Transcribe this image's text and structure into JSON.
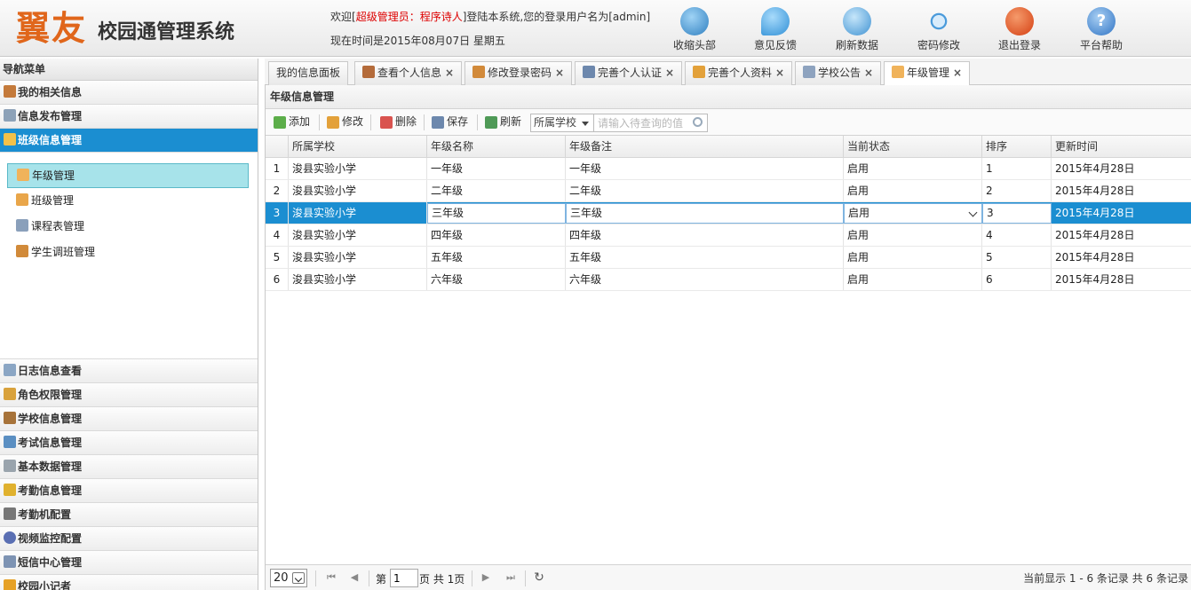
{
  "header": {
    "logo": "翼友",
    "system_name": "校园通管理系统",
    "welcome_prefix": "欢迎[",
    "welcome_role": "超级管理员：程序诗人",
    "welcome_suffix": "]登陆本系统,您的登录用户名为[admin]",
    "current_time": "现在时间是2015年08月07日 星期五",
    "buttons": [
      {
        "label": "收缩头部",
        "icon": "collapse-icon",
        "color": "#3a8fc9"
      },
      {
        "label": "意见反馈",
        "icon": "chat-bubble-icon",
        "color": "#3d9fe0"
      },
      {
        "label": "刷新数据",
        "icon": "refresh-icon",
        "color": "#4aa2dc"
      },
      {
        "label": "密码修改",
        "icon": "move-arrows-icon",
        "color": "#4b9bdb"
      },
      {
        "label": "退出登录",
        "icon": "power-icon",
        "color": "#e2501f"
      },
      {
        "label": "平台帮助",
        "icon": "help-icon",
        "color": "#3f8ed6"
      }
    ]
  },
  "nav": {
    "title": "导航菜单",
    "top_groups": [
      {
        "label": "我的相关信息",
        "icon": "user-icon",
        "color": "#c47a3b"
      },
      {
        "label": "信息发布管理",
        "icon": "document-icon",
        "color": "#8da2b8"
      },
      {
        "label": "班级信息管理",
        "icon": "home-icon",
        "color": "#f3c14a"
      }
    ],
    "sub_items": [
      {
        "label": "年级管理",
        "icon": "hourglass-icon",
        "color": "#f0b35b"
      },
      {
        "label": "班级管理",
        "icon": "house-icon",
        "color": "#e9a64a"
      },
      {
        "label": "课程表管理",
        "icon": "calendar-icon",
        "color": "#8aa0bb"
      },
      {
        "label": "学生调班管理",
        "icon": "users-icon",
        "color": "#d18a3a"
      }
    ],
    "bottom_groups": [
      {
        "label": "日志信息查看",
        "icon": "log-icon",
        "color": "#8ba6c4"
      },
      {
        "label": "角色权限管理",
        "icon": "role-key-icon",
        "color": "#d9a23c"
      },
      {
        "label": "学校信息管理",
        "icon": "school-icon",
        "color": "#a7733a"
      },
      {
        "label": "考试信息管理",
        "icon": "exam-icon",
        "color": "#5b8fc2"
      },
      {
        "label": "基本数据管理",
        "icon": "database-icon",
        "color": "#9aa4ad"
      },
      {
        "label": "考勤信息管理",
        "icon": "lock-icon",
        "color": "#e0b12e"
      },
      {
        "label": "考勤机配置",
        "icon": "keyboard-icon",
        "color": "#777777"
      },
      {
        "label": "视频监控配置",
        "icon": "eye-icon",
        "color": "#5a6fb3"
      },
      {
        "label": "短信中心管理",
        "icon": "mail-icon",
        "color": "#7d93b3"
      },
      {
        "label": "校园小记者",
        "icon": "medal-icon",
        "color": "#e6a126"
      }
    ]
  },
  "tabs": [
    {
      "label": "我的信息面板",
      "closable": false,
      "icon": ""
    },
    {
      "label": "查看个人信息",
      "closable": true,
      "icon": "id-card-icon",
      "color": "#b46b3a"
    },
    {
      "label": "修改登录密码",
      "closable": true,
      "icon": "pencil-icon",
      "color": "#d28a3a"
    },
    {
      "label": "完善个人认证",
      "closable": true,
      "icon": "phone-icon",
      "color": "#6d88ad"
    },
    {
      "label": "完善个人资料",
      "closable": true,
      "icon": "brush-icon",
      "color": "#e3a13a"
    },
    {
      "label": "学校公告",
      "closable": true,
      "icon": "notice-icon",
      "color": "#8ea3bf"
    },
    {
      "label": "年级管理",
      "closable": true,
      "icon": "hourglass-icon",
      "color": "#f0b35b"
    }
  ],
  "tab_close": "×",
  "panel": {
    "title": "年级信息管理",
    "toolbar": {
      "add": "添加",
      "edit": "修改",
      "delete": "删除",
      "save": "保存",
      "refresh": "刷新",
      "school_filter": "所属学校",
      "search_placeholder": "请输入待查询的值"
    },
    "columns": [
      "所属学校",
      "年级名称",
      "年级备注",
      "当前状态",
      "排序",
      "更新时间"
    ],
    "rows": [
      {
        "n": "1",
        "school": "浚县实验小学",
        "grade": "一年级",
        "note": "一年级",
        "status": "启用",
        "order": "1",
        "updated": "2015年4月28日"
      },
      {
        "n": "2",
        "school": "浚县实验小学",
        "grade": "二年级",
        "note": "二年级",
        "status": "启用",
        "order": "2",
        "updated": "2015年4月28日"
      },
      {
        "n": "3",
        "school": "浚县实验小学",
        "grade": "三年级",
        "note": "三年级",
        "status": "启用",
        "order": "3",
        "updated": "2015年4月28日"
      },
      {
        "n": "4",
        "school": "浚县实验小学",
        "grade": "四年级",
        "note": "四年级",
        "status": "启用",
        "order": "4",
        "updated": "2015年4月28日"
      },
      {
        "n": "5",
        "school": "浚县实验小学",
        "grade": "五年级",
        "note": "五年级",
        "status": "启用",
        "order": "5",
        "updated": "2015年4月28日"
      },
      {
        "n": "6",
        "school": "浚县实验小学",
        "grade": "六年级",
        "note": "六年级",
        "status": "启用",
        "order": "6",
        "updated": "2015年4月28日"
      }
    ],
    "selected_row": 3,
    "pager": {
      "page_size": "20",
      "page_prefix": "第",
      "page_value": "1",
      "page_suffix": "页 共 1页",
      "info": "当前显示 1 - 6 条记录 共 6 条记录"
    }
  }
}
